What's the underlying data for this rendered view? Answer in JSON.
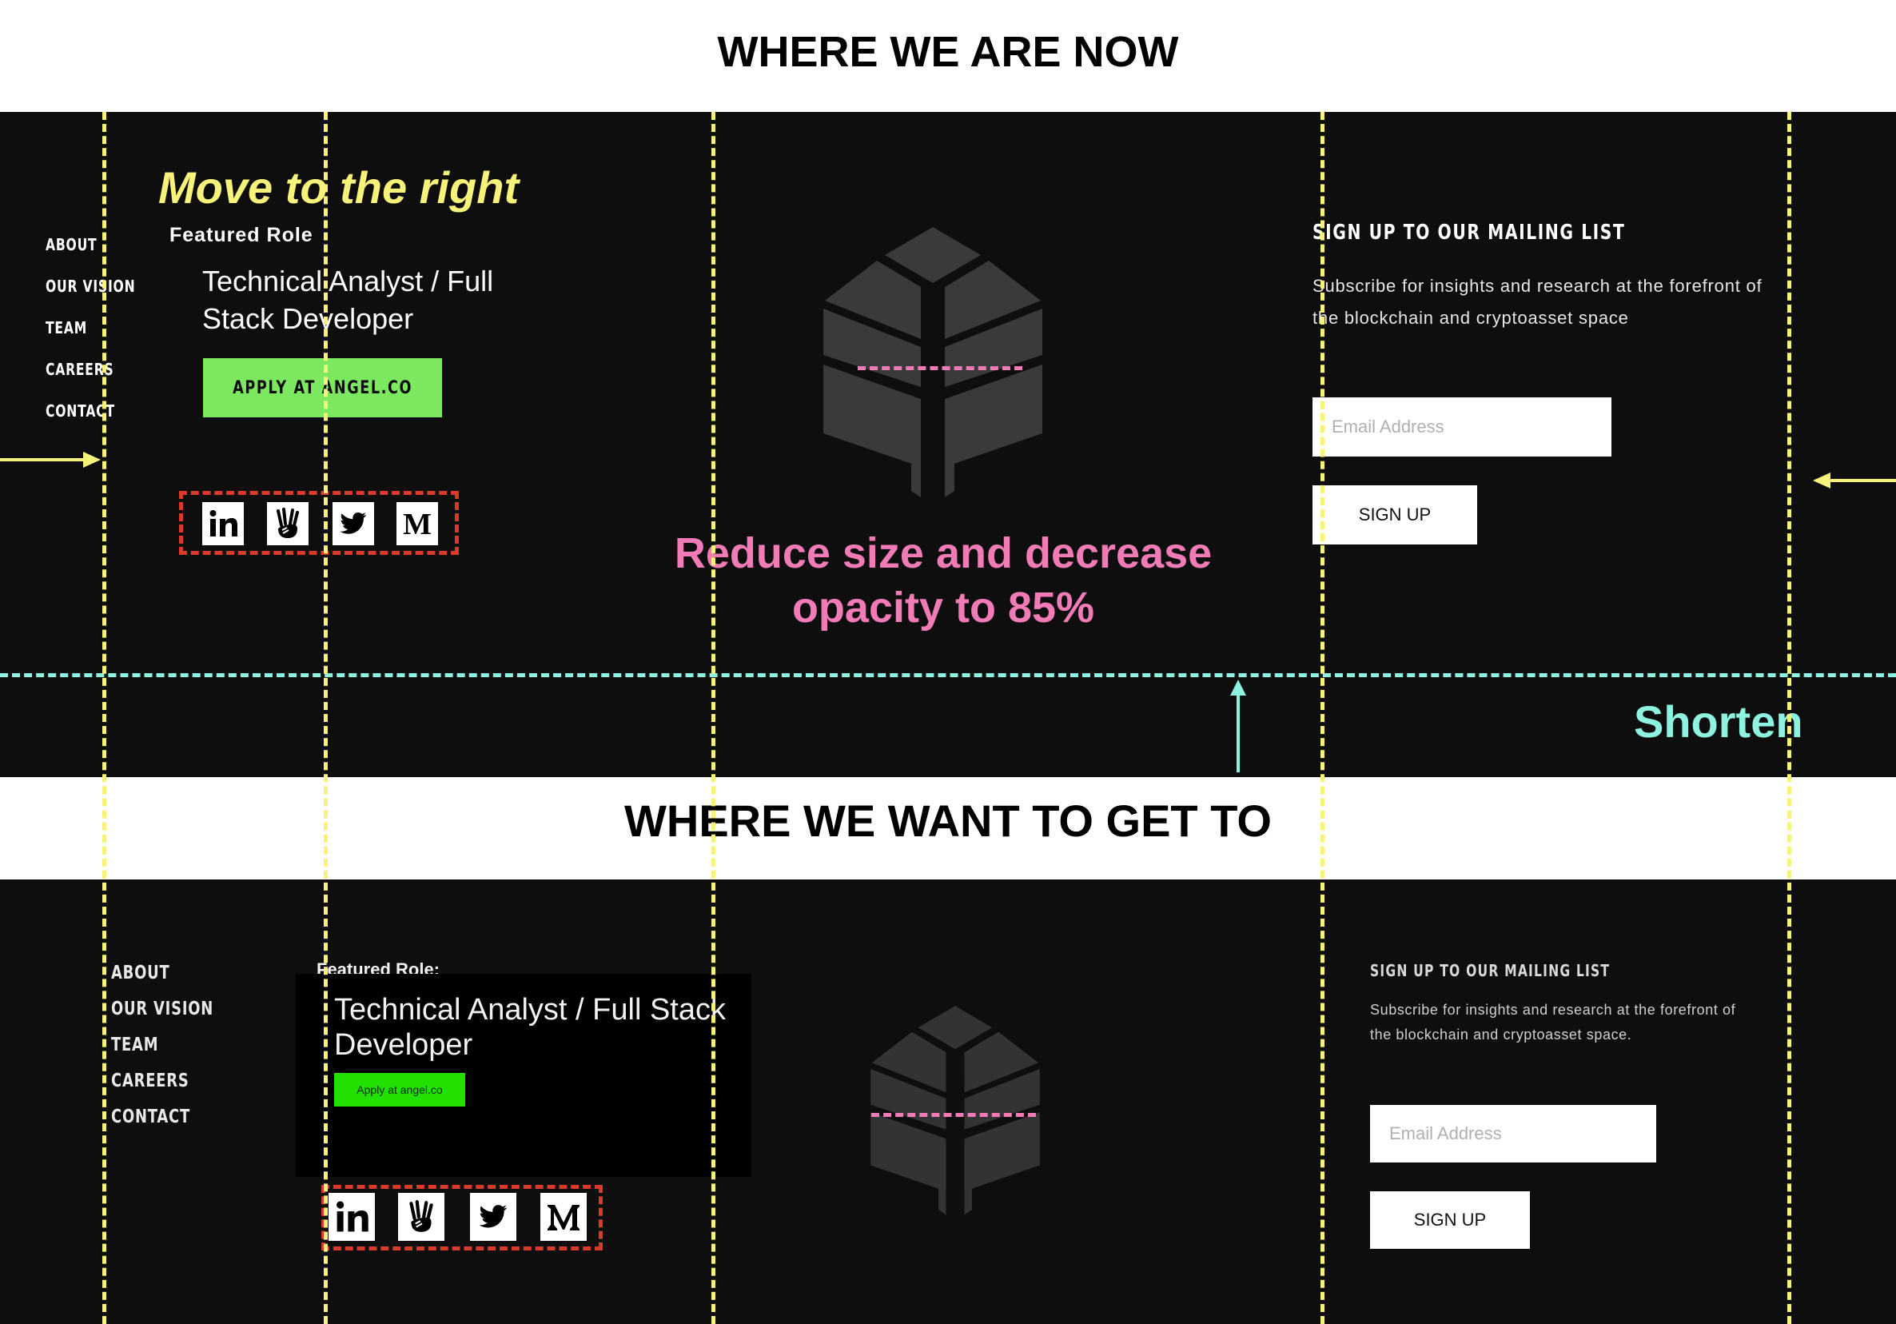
{
  "headings": {
    "now": "WHERE WE ARE NOW",
    "goal": "WHERE WE WANT TO GET TO"
  },
  "annotations": {
    "move_right": "Move to the right",
    "reduce_line1": "Reduce size and decrease",
    "reduce_line2": "opacity to 85%",
    "shorten": "Shorten",
    "colors": {
      "yellow": "#f6f27a",
      "pink": "#f07bb7",
      "cyan": "#8ef2e0",
      "red": "#d93a2b"
    }
  },
  "current": {
    "nav": [
      "ABOUT",
      "OUR VISION",
      "TEAM",
      "CAREERS",
      "CONTACT"
    ],
    "featured_label": "Featured Role",
    "role_line1": "Technical Analyst / Full",
    "role_line2": "Stack Developer",
    "apply_label": "APPLY AT ANGEL.CO",
    "mailing_title": "SIGN UP TO OUR MAILING LIST",
    "mailing_line1": "Subscribe for insights and research at the forefront of",
    "mailing_line2": "the blockchain and cryptoasset space",
    "email_placeholder": "Email Address",
    "signup_label": "SIGN UP",
    "colors": {
      "background": "#0e0e0e",
      "apply_button": "#7ce860"
    }
  },
  "target": {
    "nav": [
      "ABOUT",
      "OUR VISION",
      "TEAM",
      "CAREERS",
      "CONTACT"
    ],
    "featured_label": "Featured Role:",
    "role_line1": "Technical Analyst / Full Stack",
    "role_line2": "Developer",
    "apply_label": "Apply at angel.co",
    "mailing_title": "SIGN UP TO OUR MAILING LIST",
    "mailing_line1": "Subscribe for insights and research at the forefront of",
    "mailing_line2": "the blockchain and cryptoasset space.",
    "email_placeholder": "Email Address",
    "signup_label": "SIGN UP",
    "colors": {
      "background": "#0e0e0e",
      "apply_button": "#22e000",
      "role_box": "#000000"
    }
  },
  "icons": [
    "linkedin-icon",
    "angellist-icon",
    "twitter-icon",
    "medium-icon"
  ]
}
